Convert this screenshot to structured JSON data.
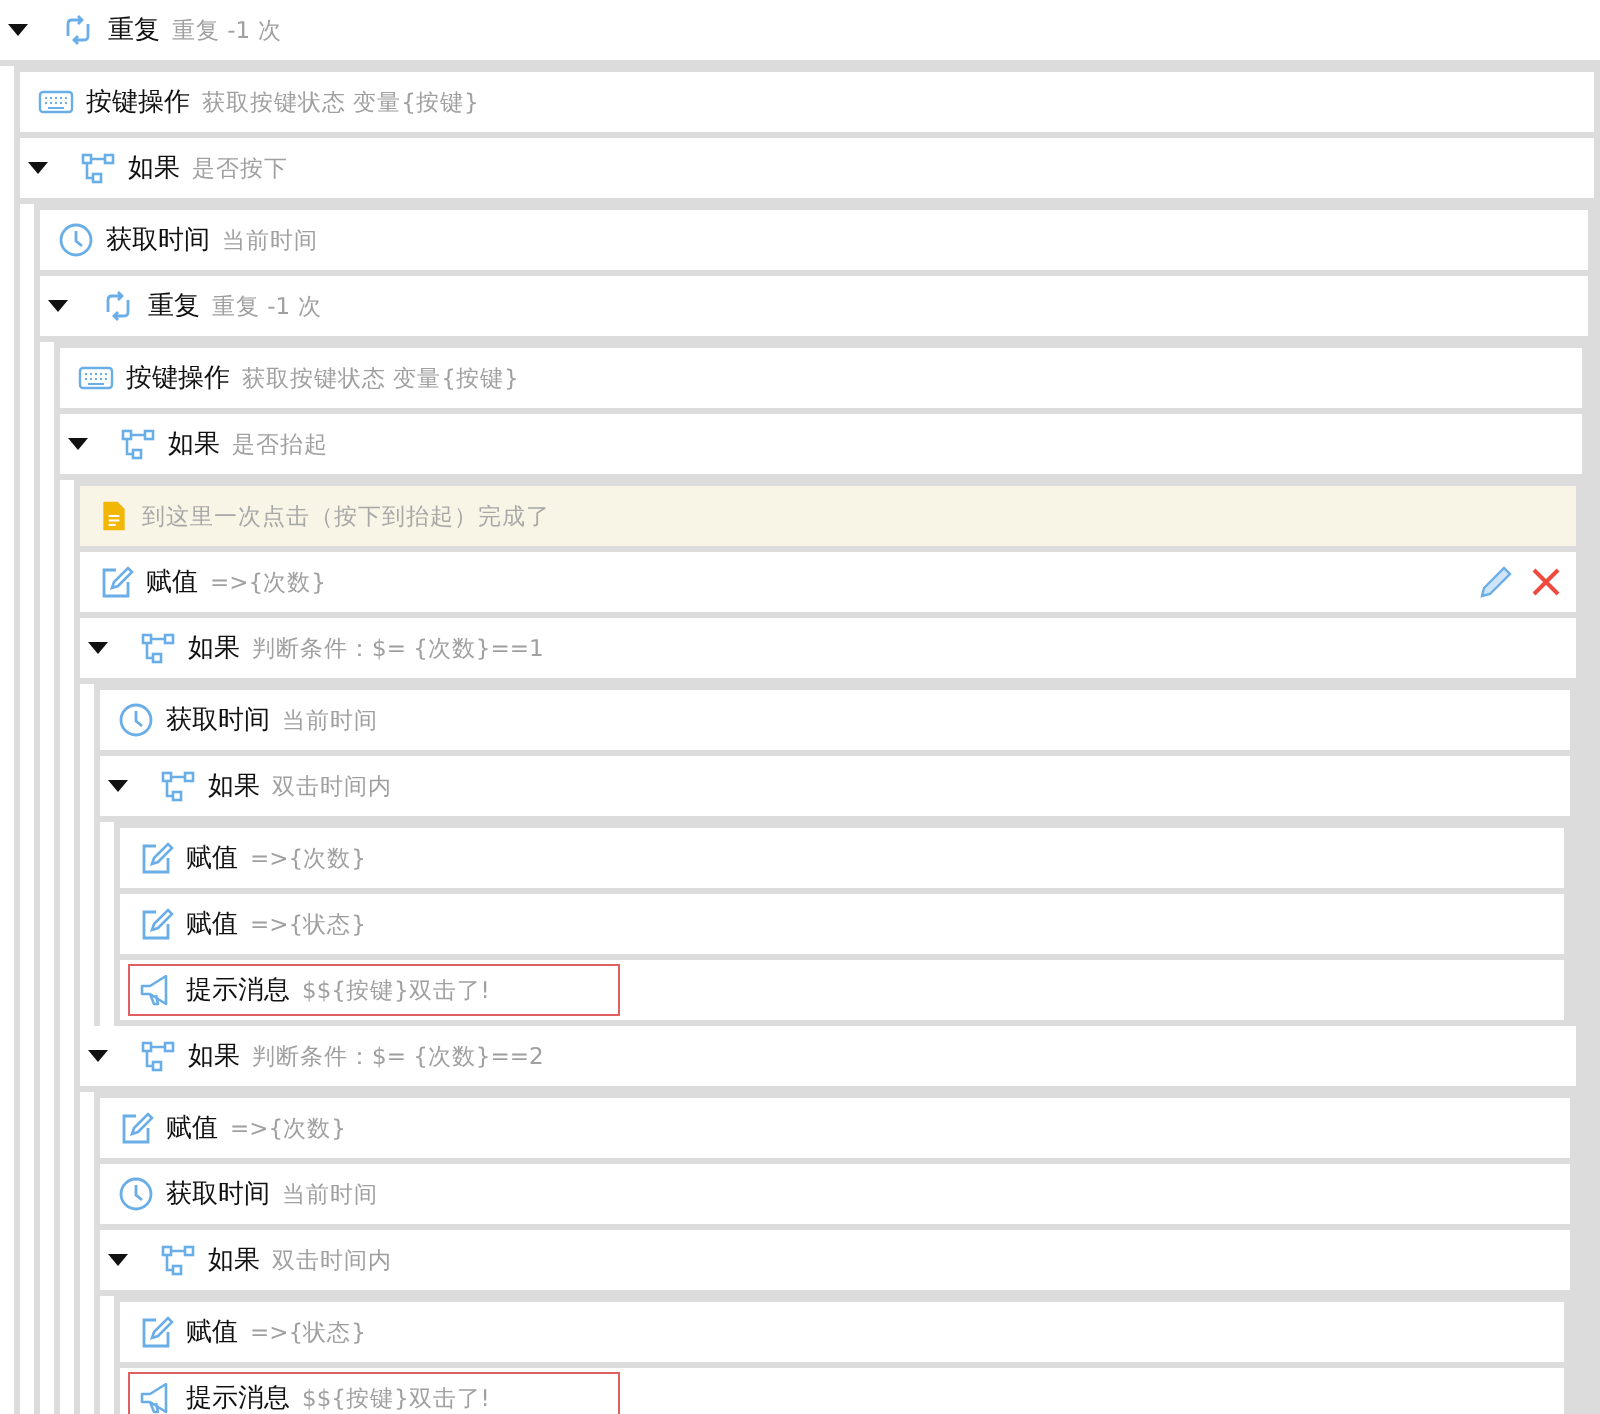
{
  "tree": {
    "kind": "repeat",
    "title": "重复",
    "detail": "重复 -1 次",
    "expanded": true,
    "children": [
      {
        "kind": "key",
        "title": "按键操作",
        "detail": "获取按键状态 变量{按键}"
      },
      {
        "kind": "if",
        "title": "如果",
        "detail": "是否按下",
        "expanded": true,
        "children": [
          {
            "kind": "time",
            "title": "获取时间",
            "detail": "当前时间"
          },
          {
            "kind": "repeat",
            "title": "重复",
            "detail": "重复 -1 次",
            "expanded": true,
            "children": [
              {
                "kind": "key",
                "title": "按键操作",
                "detail": "获取按键状态 变量{按键}"
              },
              {
                "kind": "if",
                "title": "如果",
                "detail": "是否抬起",
                "expanded": true,
                "children": [
                  {
                    "kind": "note",
                    "detail": "到这里一次点击（按下到抬起）完成了"
                  },
                  {
                    "kind": "assign",
                    "title": "赋值",
                    "detail": "=>{次数}",
                    "hovered": true
                  },
                  {
                    "kind": "if",
                    "title": "如果",
                    "detail": "判断条件：$= {次数}==1",
                    "expanded": true,
                    "children": [
                      {
                        "kind": "time",
                        "title": "获取时间",
                        "detail": "当前时间"
                      },
                      {
                        "kind": "if",
                        "title": "如果",
                        "detail": "双击时间内",
                        "expanded": true,
                        "children": [
                          {
                            "kind": "assign",
                            "title": "赋值",
                            "detail": "=>{次数}"
                          },
                          {
                            "kind": "assign",
                            "title": "赋值",
                            "detail": "=>{状态}"
                          },
                          {
                            "kind": "message",
                            "title": "提示消息",
                            "detail": "$${按键}双击了!",
                            "highlighted": true
                          }
                        ]
                      }
                    ]
                  },
                  {
                    "kind": "if",
                    "title": "如果",
                    "detail": "判断条件：$= {次数}==2",
                    "expanded": true,
                    "children": [
                      {
                        "kind": "assign",
                        "title": "赋值",
                        "detail": "=>{次数}"
                      },
                      {
                        "kind": "time",
                        "title": "获取时间",
                        "detail": "当前时间"
                      },
                      {
                        "kind": "if",
                        "title": "如果",
                        "detail": "双击时间内",
                        "expanded": true,
                        "children": [
                          {
                            "kind": "assign",
                            "title": "赋值",
                            "detail": "=>{状态}"
                          },
                          {
                            "kind": "message",
                            "title": "提示消息",
                            "detail": "$${按键}双击了!",
                            "highlighted": true
                          }
                        ]
                      }
                    ]
                  }
                ]
              }
            ]
          }
        ]
      }
    ]
  }
}
